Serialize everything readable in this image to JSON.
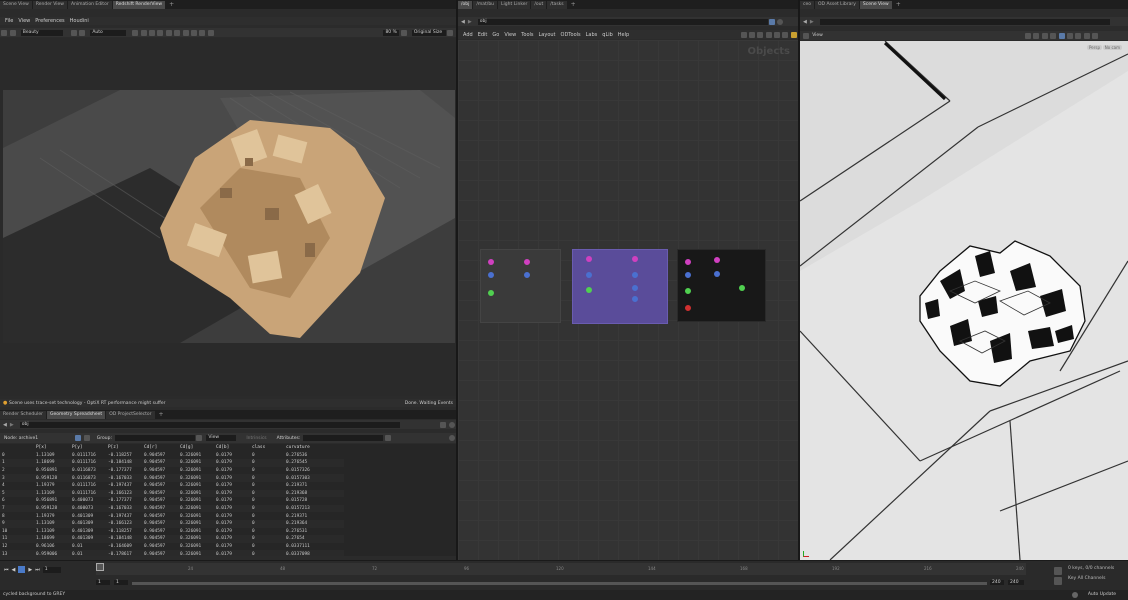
{
  "left_panel": {
    "tabs": [
      "Scene View",
      "Render View",
      "Animation Editor",
      "Redshift RenderView"
    ],
    "active_tab": 3,
    "menu": [
      "File",
      "View",
      "Preferences",
      "Houdini"
    ],
    "aov": "Beauty",
    "auto": "Auto",
    "zoom": "80 %",
    "size_mode": "Original Size",
    "status_msg": "Scene uses trace-set technology - OptiX RT performance might suffer",
    "status_right": "Done. Waiting Events"
  },
  "spreadsheet": {
    "tabs": [
      "Render Scheduler",
      "Geometry Spreadsheet",
      "OD ProjectSelector"
    ],
    "active_tab": 1,
    "path": "obj",
    "node_label": "Node: archive1",
    "group_label": "Group:",
    "view_label": "View",
    "intrinsics_label": "Intrinsics",
    "attributes_label": "Attributes:",
    "columns": [
      "",
      "P[x]",
      "P[y]",
      "P[z]",
      "Cd[r]",
      "Cd[g]",
      "Cd[b]",
      "class",
      "curvature"
    ],
    "rows": [
      [
        "0",
        "1.13109",
        "0.0111716",
        "-0.118257",
        "0.904597",
        "0.326091",
        "0.0179",
        "0",
        "0.276536"
      ],
      [
        "1",
        "1.18699",
        "0.0111716",
        "-0.184148",
        "0.904597",
        "0.326091",
        "0.0179",
        "0",
        "0.276545"
      ],
      [
        "2",
        "0.956891",
        "0.0116873",
        "-0.177377",
        "0.904597",
        "0.326091",
        "0.0179",
        "0",
        "0.0157326"
      ],
      [
        "3",
        "0.959128",
        "0.0116873",
        "-0.167033",
        "0.904597",
        "0.326091",
        "0.0179",
        "0",
        "0.0157303"
      ],
      [
        "4",
        "1.19379",
        "0.0111716",
        "-0.197437",
        "0.904597",
        "0.326091",
        "0.0179",
        "0",
        "0.219371"
      ],
      [
        "5",
        "1.13109",
        "0.0111716",
        "-0.166123",
        "0.904597",
        "0.326091",
        "0.0179",
        "0",
        "0.219368"
      ],
      [
        "6",
        "0.956891",
        "0.400073",
        "-0.177377",
        "0.904597",
        "0.326091",
        "0.0179",
        "0",
        "0.015728"
      ],
      [
        "7",
        "0.959128",
        "0.400073",
        "-0.167033",
        "0.904597",
        "0.326091",
        "0.0179",
        "0",
        "0.0157213"
      ],
      [
        "8",
        "1.19379",
        "0.401309",
        "-0.197437",
        "0.904597",
        "0.326091",
        "0.0179",
        "0",
        "0.219371"
      ],
      [
        "9",
        "1.13109",
        "0.401309",
        "-0.166123",
        "0.904597",
        "0.326091",
        "0.0179",
        "0",
        "0.219364"
      ],
      [
        "10",
        "1.13109",
        "0.401309",
        "-0.118257",
        "0.904597",
        "0.326091",
        "0.0179",
        "0",
        "0.276531"
      ],
      [
        "11",
        "1.18699",
        "0.401309",
        "-0.184148",
        "0.904597",
        "0.326091",
        "0.0179",
        "0",
        "0.27654"
      ],
      [
        "12",
        "0.96106",
        "0.01",
        "-0.164609",
        "0.904597",
        "0.326091",
        "0.0179",
        "0",
        "0.0337111"
      ],
      [
        "13",
        "0.959006",
        "0.01",
        "-0.178617",
        "0.904597",
        "0.326091",
        "0.0179",
        "0",
        "0.0337098"
      ]
    ]
  },
  "middle_panel": {
    "tabs": [
      "/obj",
      "/mat/bu",
      "Light Linker",
      "/out",
      "/tasks"
    ],
    "active_tab": 0,
    "path": "obj",
    "menu": [
      "Add",
      "Edit",
      "Go",
      "View",
      "Tools",
      "Layout",
      "ODTools",
      "Labs",
      "qLib",
      "Help"
    ],
    "context_label": "Objects",
    "box_colors": [
      "#3a3a3a",
      "#5a4c9a",
      "#181818"
    ]
  },
  "right_panel": {
    "tabs": [
      "ceo",
      "OD Asset Library",
      "Scene View"
    ],
    "active_tab": 2,
    "view_label": "View",
    "persp_label": "Persp",
    "cam_label": "No cam"
  },
  "timeline": {
    "ticks": [
      "1",
      "24",
      "48",
      "72",
      "96",
      "120",
      "144",
      "168",
      "192",
      "216",
      "240"
    ],
    "current_frame": "1",
    "start": "1",
    "start2": "1",
    "end": "240",
    "end2": "240",
    "keys_info": "0 keys, 0/0 channels",
    "key_all": "Key All Channels",
    "auto_update": "Auto Update"
  },
  "statusbar": {
    "message": "cycled background to GREY"
  }
}
